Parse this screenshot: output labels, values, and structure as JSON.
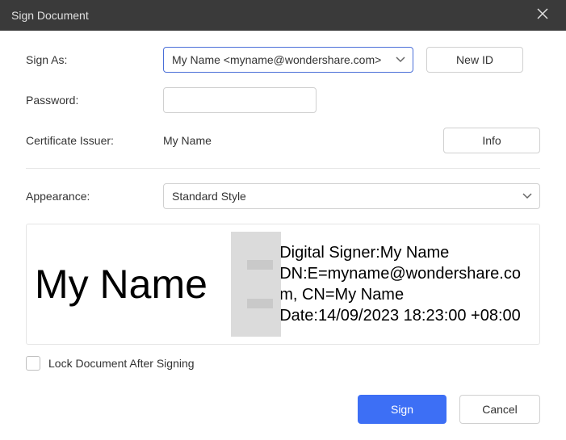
{
  "titlebar": {
    "title": "Sign Document"
  },
  "form": {
    "sign_as_label": "Sign As:",
    "sign_as_value": "My Name <myname@wondershare.com>",
    "new_id_label": "New ID",
    "password_label": "Password:",
    "password_value": "",
    "cert_issuer_label": "Certificate Issuer:",
    "cert_issuer_value": "My Name",
    "info_label": "Info",
    "appearance_label": "Appearance:",
    "appearance_value": "Standard Style"
  },
  "preview": {
    "name": "My Name",
    "line1": "Digital Signer:My Name",
    "line2": "DN:E=myname@wondershare.com, CN=My Name",
    "line3": "Date:14/09/2023 18:23:00 +08:00"
  },
  "checkbox": {
    "lock_label": "Lock Document After Signing",
    "lock_checked": false
  },
  "footer": {
    "sign_label": "Sign",
    "cancel_label": "Cancel"
  }
}
